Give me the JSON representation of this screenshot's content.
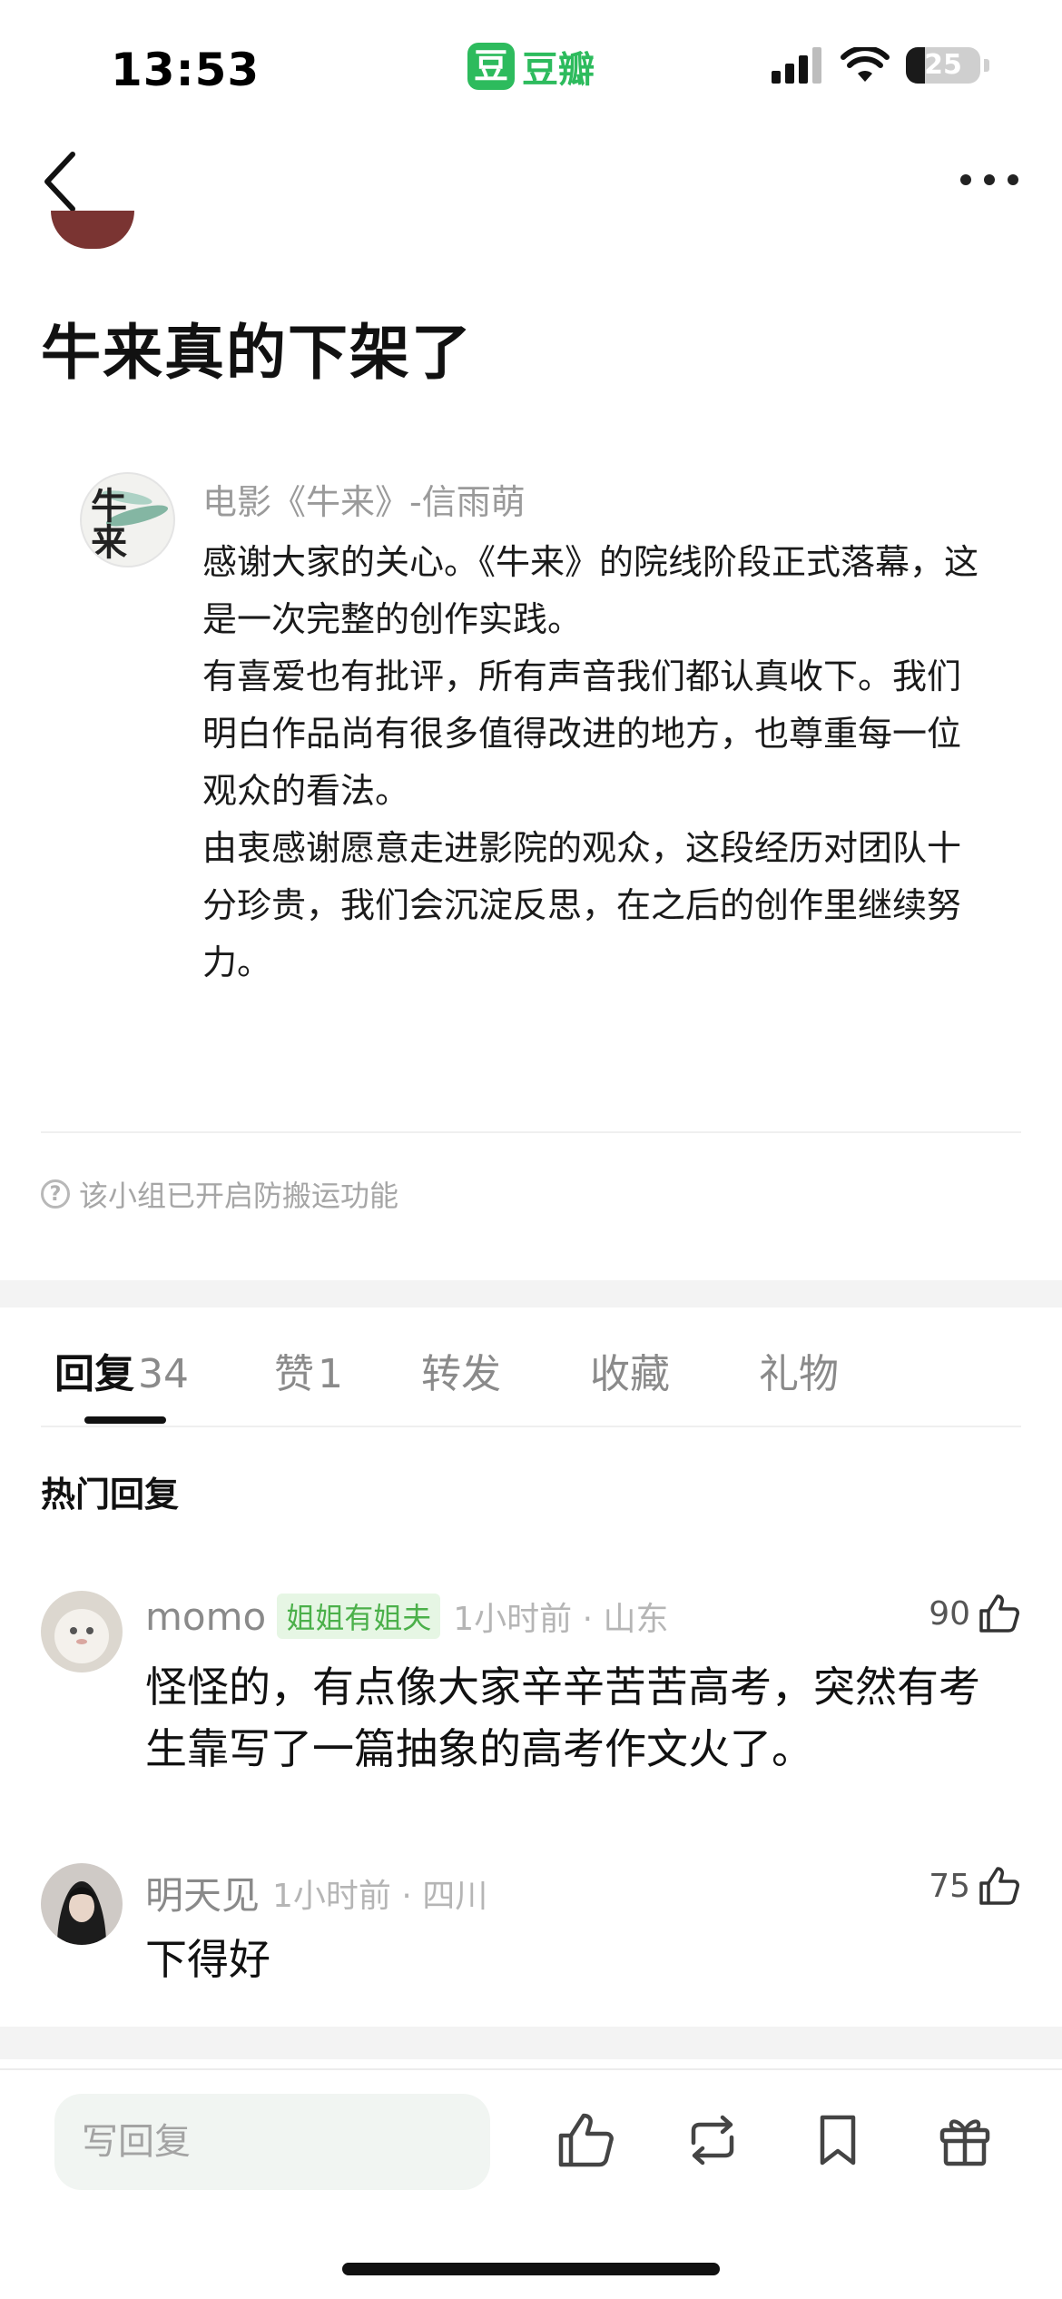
{
  "status_bar": {
    "time": "13:53",
    "app_logo_char": "豆",
    "app_name": "豆瓣",
    "battery": "25",
    "battery_level": 0.25,
    "icons": [
      "cellular-signal-icon",
      "wifi-icon",
      "battery-icon"
    ]
  },
  "nav": {
    "icons": [
      "chevron-left-icon",
      "more-dots-icon"
    ]
  },
  "post": {
    "title": "牛来真的下架了"
  },
  "quote": {
    "avatar_glyph": "牛来",
    "name": "电影《牛来》-信雨萌",
    "paragraphs": [
      "感谢大家的关心。《牛来》的院线阶段正式落幕，这是一次完整的创作实践。",
      "有喜爱也有批评，所有声音我们都认真收下。我们明白作品尚有很多值得改进的地方，也尊重每一位观众的看法。",
      "由衷感谢愿意走进影院的观众，这段经历对团队十分珍贵，我们会沉淀反思，在之后的创作里继续努力。"
    ]
  },
  "notice": {
    "icon": "question-circle-icon",
    "text": "该小组已开启防搬运功能"
  },
  "tabs": [
    {
      "label": "回复",
      "count": "34",
      "active": true
    },
    {
      "label": "赞",
      "count": "1",
      "active": false
    },
    {
      "label": "转发",
      "count": "",
      "active": false
    },
    {
      "label": "收藏",
      "count": "",
      "active": false
    },
    {
      "label": "礼物",
      "count": "",
      "active": false
    }
  ],
  "hot_replies": {
    "title": "热门回复",
    "items": [
      {
        "name": "momo",
        "badge": "姐姐有姐夫",
        "meta": "1小时前 · 山东",
        "likes": "90",
        "text": "怪怪的，有点像大家辛辛苦苦高考，突然有考生靠写了一篇抽象的高考作文火了。"
      },
      {
        "name": "明天见",
        "badge": "",
        "meta": "1小时前 · 四川",
        "likes": "75",
        "text": "下得好"
      }
    ]
  },
  "bottom_bar": {
    "reply_placeholder": "写回复",
    "icons": [
      "thumbs-up-icon",
      "repost-icon",
      "bookmark-icon",
      "gift-icon"
    ]
  },
  "colors": {
    "brand_green": "#2dbb5d",
    "badge_green": "#4bb04a",
    "badge_bg": "#e6f6e4"
  }
}
